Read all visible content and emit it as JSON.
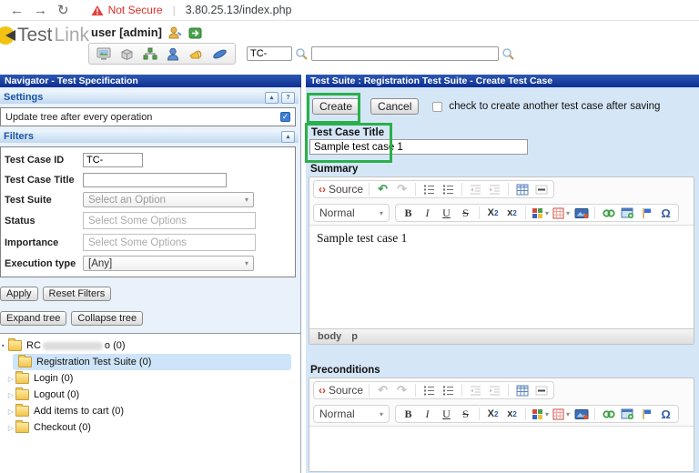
{
  "browser": {
    "not_secure_label": "Not Secure",
    "url": "3.80.25.13/index.php"
  },
  "header": {
    "logo_primary": "Test",
    "logo_secondary": "Link",
    "user_label": "user [admin]",
    "tc_prefix_value": "TC-",
    "search_value": ""
  },
  "left_panel": {
    "title": "Navigator - Test Specification",
    "settings": {
      "title": "Settings",
      "update_tree_label": "Update tree after every operation"
    },
    "filters": {
      "title": "Filters",
      "fields": [
        {
          "label": "Test Case ID",
          "value": "TC-"
        },
        {
          "label": "Test Case Title",
          "value": ""
        },
        {
          "label": "Test Suite",
          "value": "Select an Option"
        },
        {
          "label": "Status",
          "placeholder": "Select Some Options"
        },
        {
          "label": "Importance",
          "placeholder": "Select Some Options"
        },
        {
          "label": "Execution type",
          "value": "[Any]"
        }
      ],
      "apply_label": "Apply",
      "reset_label": "Reset Filters"
    },
    "tree_toolbar": {
      "expand_label": "Expand tree",
      "collapse_label": "Collapse tree"
    },
    "tree": {
      "root_prefix": "RC",
      "root_suffix": "o (0)",
      "items": [
        {
          "label": "Registration Test Suite (0)"
        },
        {
          "label": "Login (0)"
        },
        {
          "label": "Logout (0)"
        },
        {
          "label": "Add items to cart (0)"
        },
        {
          "label": "Checkout (0)"
        }
      ]
    }
  },
  "right_panel": {
    "title": "Test Suite : Registration Test Suite - Create Test Case",
    "create_label": "Create",
    "cancel_label": "Cancel",
    "create_another_label": "check to create another test case after saving",
    "title_field": {
      "label": "Test Case Title",
      "value": "Sample test case 1"
    },
    "summary": {
      "label": "Summary",
      "content": "Sample test case 1",
      "status_path": [
        "body",
        "p"
      ]
    },
    "preconditions": {
      "label": "Preconditions",
      "content": ""
    },
    "editor": {
      "source_label": "Source",
      "format_value": "Normal"
    }
  },
  "glyphs": {
    "back": "←",
    "forward": "→",
    "reload": "↻",
    "divider": "|",
    "collapse": "▴",
    "help": "?",
    "dropdown": "▾",
    "tree_expand": "▷",
    "root_marker": "▪",
    "check": "✓",
    "source_brackets": "‹›",
    "undo": "↶",
    "redo": "↷",
    "bold": "B",
    "italic": "I",
    "underline": "U",
    "strike": "S",
    "sub_base": "X",
    "sub_num": "2",
    "sup_base": "x",
    "sup_num": "2",
    "omega": "Ω"
  },
  "colors": {
    "annotation_green": "#2ab04a",
    "titlebar_blue": "#0d2e92",
    "panel_blue": "#d5e6f7",
    "selection_blue": "#cde4f9",
    "not_secure_red": "#d93025"
  }
}
